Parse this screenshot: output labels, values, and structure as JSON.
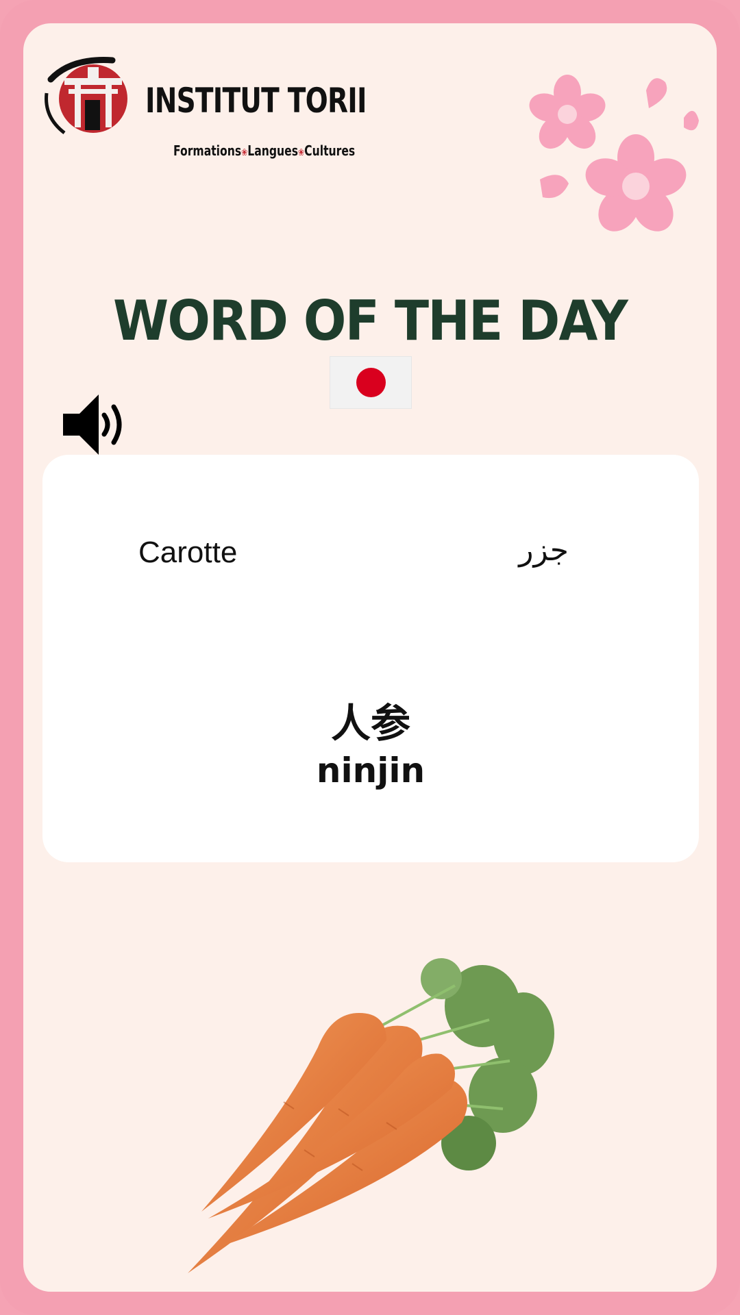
{
  "brand": {
    "name": "INSTITUT TORII",
    "tagline_parts": [
      "Formations",
      "Langues",
      "Cultures"
    ]
  },
  "title": "WORD OF THE DAY",
  "language_flag": "japan-flag",
  "audio_icon": "speaker-icon",
  "word": {
    "french": "Carotte",
    "arabic": "جزر",
    "japanese": "人参",
    "romaji": "ninjin"
  },
  "illustration": "carrots",
  "colors": {
    "frame": "#f4a0b2",
    "background": "#fdf0ea",
    "title": "#1e3d2c",
    "flag_red": "#d9001e",
    "logo_red": "#c7313a"
  }
}
